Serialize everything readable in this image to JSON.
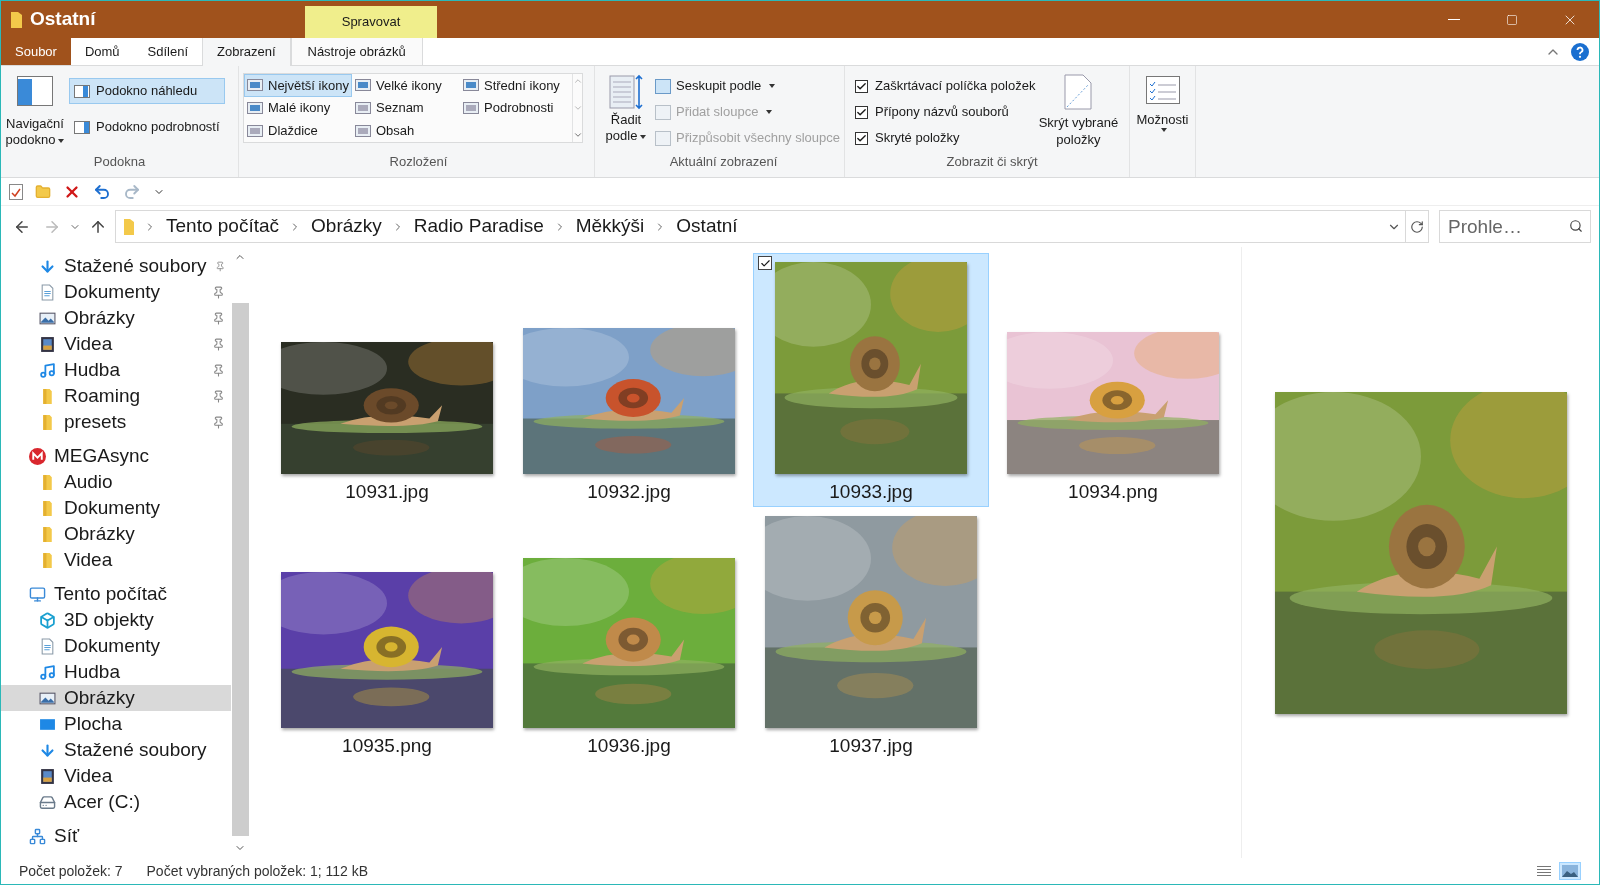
{
  "window": {
    "title": "Ostatní",
    "context_tab_header": "Spravovat"
  },
  "ribbon_tabs": [
    {
      "label": "Soubor",
      "kind": "file",
      "selected": false
    },
    {
      "label": "Domů",
      "kind": "tab",
      "selected": false
    },
    {
      "label": "Sdílení",
      "kind": "tab",
      "selected": false
    },
    {
      "label": "Zobrazení",
      "kind": "tab",
      "selected": true
    },
    {
      "label": "Nástroje obrázků",
      "kind": "context",
      "selected": false
    }
  ],
  "ribbon": {
    "panes": {
      "label": "Podokna",
      "navigation": "Navigační podokno",
      "buttons": [
        {
          "label": "Podokno náhledu",
          "selected": true
        },
        {
          "label": "Podokno podrobností",
          "selected": false
        }
      ]
    },
    "layout": {
      "label": "Rozložení",
      "options": [
        {
          "label": "Největší ikony",
          "selected": true
        },
        {
          "label": "Velké ikony",
          "selected": false
        },
        {
          "label": "Střední ikony",
          "selected": false
        },
        {
          "label": "Malé ikony",
          "selected": false
        },
        {
          "label": "Seznam",
          "selected": false
        },
        {
          "label": "Podrobnosti",
          "selected": false
        },
        {
          "label": "Dlaždice",
          "selected": false
        },
        {
          "label": "Obsah",
          "selected": false
        }
      ]
    },
    "current_view": {
      "label": "Aktuální zobrazení",
      "sort": "Řadit podle",
      "items": [
        {
          "label": "Seskupit podle",
          "disabled": false
        },
        {
          "label": "Přidat sloupce",
          "disabled": true
        },
        {
          "label": "Přizpůsobit všechny sloupce",
          "disabled": true
        }
      ]
    },
    "show_hide": {
      "label": "Zobrazit či skrýt",
      "checkboxes": [
        {
          "label": "Zaškrtávací políčka položek",
          "checked": true
        },
        {
          "label": "Přípony názvů souborů",
          "checked": true
        },
        {
          "label": "Skryté položky",
          "checked": true
        }
      ],
      "hide_selected": "Skrýt vybrané položky"
    },
    "options": {
      "label": "Možnosti"
    }
  },
  "breadcrumbs": [
    "Tento počítač",
    "Obrázky",
    "Radio Paradise",
    "Měkkýši",
    "Ostatní"
  ],
  "search": {
    "placeholder": "Prohle…"
  },
  "quick_access": [
    {
      "label": "Stažené soubory",
      "kind": "download",
      "pinned": true,
      "selected": false
    },
    {
      "label": "Dokumenty",
      "kind": "document",
      "pinned": true,
      "selected": false
    },
    {
      "label": "Obrázky",
      "kind": "pictures",
      "pinned": true,
      "selected": false
    },
    {
      "label": "Videa",
      "kind": "video",
      "pinned": true,
      "selected": false
    },
    {
      "label": "Hudba",
      "kind": "music",
      "pinned": true,
      "selected": false
    },
    {
      "label": "Roaming",
      "kind": "folder",
      "pinned": true,
      "selected": false
    },
    {
      "label": "presets",
      "kind": "folder",
      "pinned": true,
      "selected": false
    }
  ],
  "nav_tree": [
    {
      "label": "MEGAsync",
      "kind": "mega",
      "selected": false,
      "children": [
        {
          "label": "Audio",
          "kind": "folder",
          "selected": false
        },
        {
          "label": "Dokumenty",
          "kind": "folder",
          "selected": false
        },
        {
          "label": "Obrázky",
          "kind": "folder",
          "selected": false
        },
        {
          "label": "Videa",
          "kind": "folder",
          "selected": false
        }
      ]
    },
    {
      "label": "Tento počítač",
      "kind": "pc",
      "selected": false,
      "children": [
        {
          "label": "3D objekty",
          "kind": "cube",
          "selected": false
        },
        {
          "label": "Dokumenty",
          "kind": "document",
          "selected": false
        },
        {
          "label": "Hudba",
          "kind": "music",
          "selected": false
        },
        {
          "label": "Obrázky",
          "kind": "pictures",
          "selected": true
        },
        {
          "label": "Plocha",
          "kind": "desktop",
          "selected": false
        },
        {
          "label": "Stažené soubory",
          "kind": "download",
          "selected": false
        },
        {
          "label": "Videa",
          "kind": "video",
          "selected": false
        },
        {
          "label": "Acer (C:)",
          "kind": "drive",
          "selected": false
        }
      ]
    },
    {
      "label": "Síť",
      "kind": "network",
      "selected": false
    }
  ],
  "files": [
    {
      "name": "10931.jpg",
      "selected": false
    },
    {
      "name": "10932.jpg",
      "selected": false
    },
    {
      "name": "10933.jpg",
      "selected": true
    },
    {
      "name": "10934.png",
      "selected": false
    },
    {
      "name": "10935.png",
      "selected": false
    },
    {
      "name": "10936.jpg",
      "selected": false
    },
    {
      "name": "10937.jpg",
      "selected": false
    }
  ],
  "status_bar": {
    "item_count": "Počet položek: 7",
    "selection": "Počet vybraných položek: 1; 112 kB",
    "view_buttons": [
      {
        "kind": "details",
        "selected": false
      },
      {
        "kind": "large_icons",
        "selected": true
      }
    ]
  }
}
